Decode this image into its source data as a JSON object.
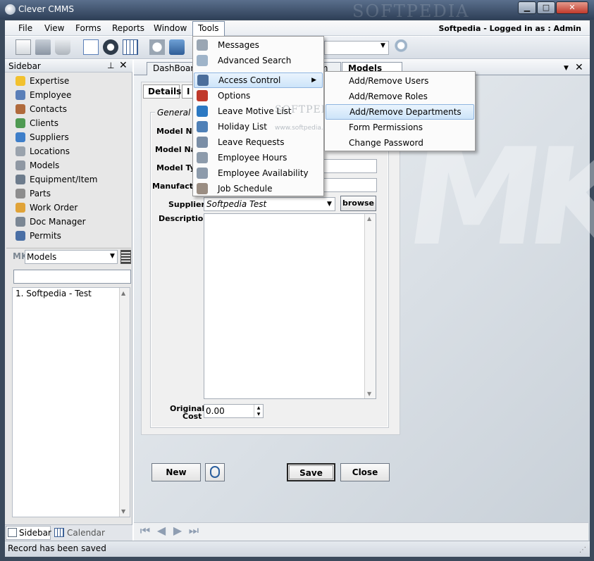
{
  "window": {
    "title": "Clever CMMS",
    "brand_watermark": "SOFTPEDIA",
    "minimize": "▁",
    "maximize": "□",
    "close": "✕"
  },
  "menubar": {
    "items": [
      "File",
      "View",
      "Forms",
      "Reports",
      "Window",
      "Tools"
    ],
    "login_text": "Softpedia - Logged in as :  Admin"
  },
  "sidebar": {
    "title": "Sidebar",
    "pin_icon": "pin-icon",
    "close_icon": "close-icon",
    "items": [
      {
        "label": "Expertise",
        "icon": "star-icon",
        "color": "#f2c12e"
      },
      {
        "label": "Employee",
        "icon": "person-icon",
        "color": "#5a7fb8"
      },
      {
        "label": "Contacts",
        "icon": "people-icon",
        "color": "#b06a3c"
      },
      {
        "label": "Clients",
        "icon": "client-icon",
        "color": "#4f9a52"
      },
      {
        "label": "Suppliers",
        "icon": "supplier-icon",
        "color": "#3f7fc9"
      },
      {
        "label": "Locations",
        "icon": "house-icon",
        "color": "#9aa3ad"
      },
      {
        "label": "Models",
        "icon": "mk-icon",
        "color": "#8f98a3"
      },
      {
        "label": "Equipment/Item",
        "icon": "globe-icon",
        "color": "#6d7c8c"
      },
      {
        "label": "Parts",
        "icon": "gear-icon",
        "color": "#8d8d8d"
      },
      {
        "label": "Work Order",
        "icon": "workorder-icon",
        "color": "#e0a338"
      },
      {
        "label": "Doc Manager",
        "icon": "doc-icon",
        "color": "#7b8794"
      },
      {
        "label": "Permits",
        "icon": "permit-icon",
        "color": "#4a6fa5"
      }
    ],
    "models_combo": "Models",
    "search_placeholder": "",
    "list_items": [
      "1. Softpedia - Test"
    ],
    "bottom_tabs": [
      "Sidebar",
      "Calendar"
    ]
  },
  "doc_tabs": [
    "DashBoard",
    "rm",
    "Models Form"
  ],
  "form": {
    "inner_tabs": [
      "Details",
      "I"
    ],
    "group_title": "General",
    "labels": {
      "model_number": "Model Nur",
      "model_name": "Model Nam",
      "model_type": "Model Typ",
      "manufacturer": "Manufactur",
      "supplier": "Supplier",
      "description": "Description",
      "original_cost_1": "Original",
      "original_cost_2": "Cost"
    },
    "supplier_value": "Softpedia Test",
    "browse_label": "browse",
    "original_cost_value": "0.00",
    "buttons": {
      "new": "New",
      "save": "Save",
      "close": "Close"
    }
  },
  "tools_menu": {
    "items": [
      {
        "label": "Messages",
        "icon": "messages-icon",
        "color": "#9aa6b3"
      },
      {
        "label": "Advanced Search",
        "icon": "magnifier-icon",
        "color": "#9fb4c9"
      },
      {
        "label": "Access Control",
        "icon": "user-key-icon",
        "color": "#4b6e9b",
        "has_submenu": true
      },
      {
        "label": "Options",
        "icon": "checkmark-icon",
        "color": "#c0392b"
      },
      {
        "label": "Leave Motive List",
        "icon": "leave-motive-icon",
        "color": "#2b78c2"
      },
      {
        "label": "Holiday List",
        "icon": "holiday-icon",
        "color": "#4f80b7"
      },
      {
        "label": "Leave Requests",
        "icon": "leave-request-icon",
        "color": "#7a8ea6"
      },
      {
        "label": "Employee Hours",
        "icon": "clock-icon",
        "color": "#8d9bab"
      },
      {
        "label": "Employee Availability",
        "icon": "availability-icon",
        "color": "#8d9bab"
      },
      {
        "label": "Job Schedule",
        "icon": "schedule-icon",
        "color": "#9a8d82"
      }
    ]
  },
  "access_submenu": {
    "items": [
      "Add/Remove Users",
      "Add/Remove Roles",
      "Add/Remove Departments",
      "Form Permissions",
      "Change Password"
    ],
    "highlighted_index": 2
  },
  "status": {
    "text": "Record has been saved"
  },
  "watermarks": {
    "softpedia_menu": "SOFTPEDIA",
    "softpedia_url": "www.softpedia.com",
    "mk": "MK"
  }
}
